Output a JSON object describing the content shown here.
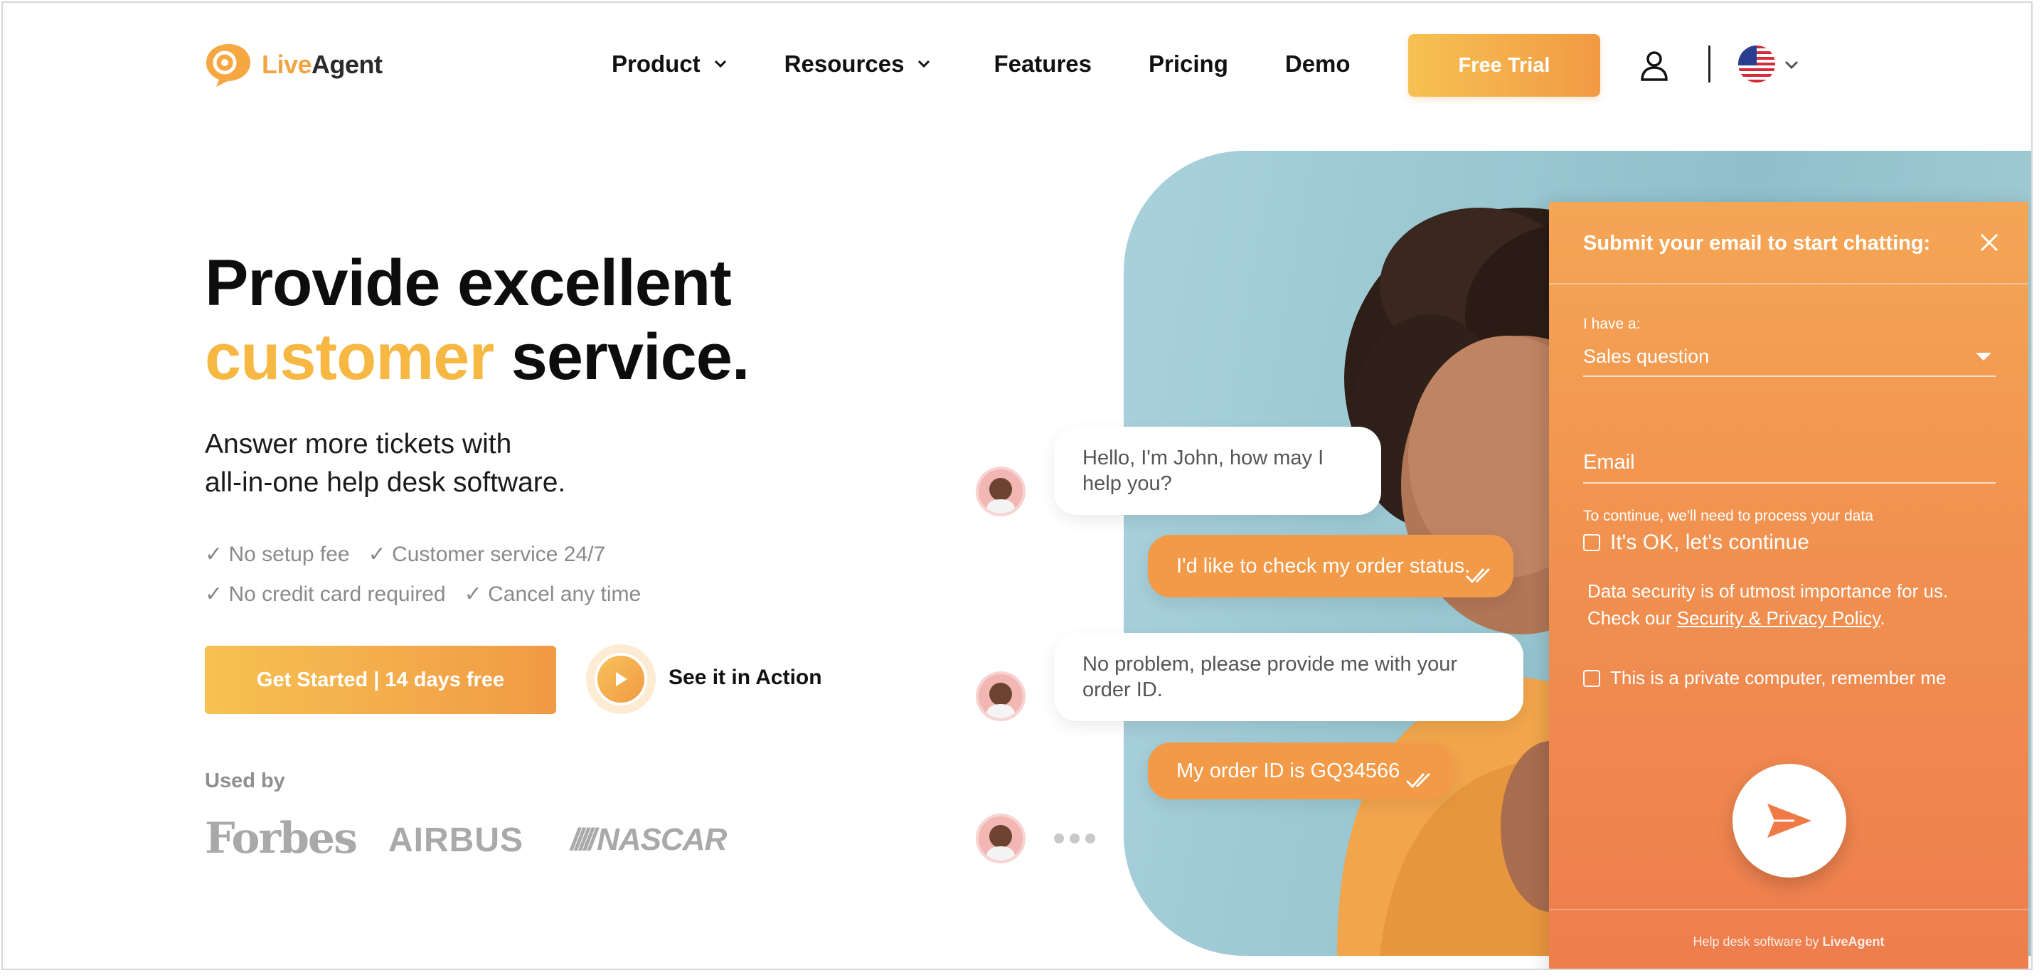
{
  "header": {
    "logo": {
      "live": "Live",
      "agent": "Agent"
    },
    "nav": [
      {
        "label": "Product",
        "dropdown": true
      },
      {
        "label": "Resources",
        "dropdown": true
      },
      {
        "label": "Features",
        "dropdown": false
      },
      {
        "label": "Pricing",
        "dropdown": false
      },
      {
        "label": "Demo",
        "dropdown": false
      }
    ],
    "cta": "Free Trial",
    "icons": [
      "user-icon",
      "us-flag-icon",
      "chevron-down-icon"
    ]
  },
  "hero": {
    "title_line1": "Provide excellent",
    "title_accent": "customer",
    "title_rest": "service.",
    "subtitle_line1": "Answer more tickets with",
    "subtitle_line2": "all-in-one help desk software.",
    "checks": [
      "✓ No setup fee",
      "✓ Customer service 24/7",
      "✓ No credit card required",
      "✓ Cancel any time"
    ],
    "primary_button": "Get Started | 14 days free",
    "video_link": "See it in Action",
    "used_by_label": "Used by",
    "brands": [
      "Forbes",
      "AIRBUS",
      "NASCAR"
    ]
  },
  "chat": {
    "messages": [
      {
        "from": "agent",
        "text": "Hello, I'm John, how may I help you?"
      },
      {
        "from": "customer",
        "text": "I'd like to check my order status."
      },
      {
        "from": "agent",
        "text": "No problem, please provide me with your order ID."
      },
      {
        "from": "customer",
        "text": "My order ID is GQ34566"
      }
    ]
  },
  "widget": {
    "title": "Submit your email to start chatting:",
    "select_label": "I have a:",
    "select_value": "Sales question",
    "email_placeholder": "Email",
    "consent_note": "To continue, we'll need to process your data",
    "consent_checkbox": "It's OK, let's continue",
    "security_line1": "Data security is of utmost importance for us.",
    "security_prefix": "Check our ",
    "security_link": "Security & Privacy Policy",
    "security_suffix": ".",
    "private_checkbox": "This is a private computer, remember me",
    "footer_prefix": "Help desk software by ",
    "footer_brand": "LiveAgent"
  },
  "colors": {
    "accent": "#f6b843",
    "orange": "#f19a44",
    "widget_bottom": "#ee7d4e"
  }
}
